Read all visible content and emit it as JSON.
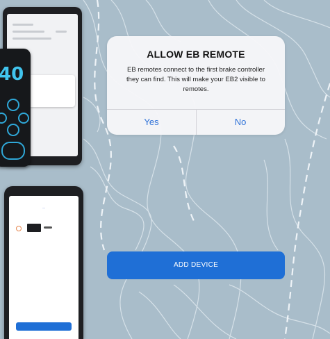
{
  "alert": {
    "title": "ALLOW EB REMOTE",
    "message": "EB remotes connect to the first brake controller they can find. This will make your EB2 visible to remotes.",
    "yes_label": "Yes",
    "no_label": "No"
  },
  "main": {
    "add_device_label": "ADD DEVICE"
  },
  "promo": {
    "remote_readout": "40"
  },
  "colors": {
    "map_background": "#a9bdca",
    "accent_blue": "#1f6fd6",
    "dialog_button_text": "#2f72d8"
  }
}
